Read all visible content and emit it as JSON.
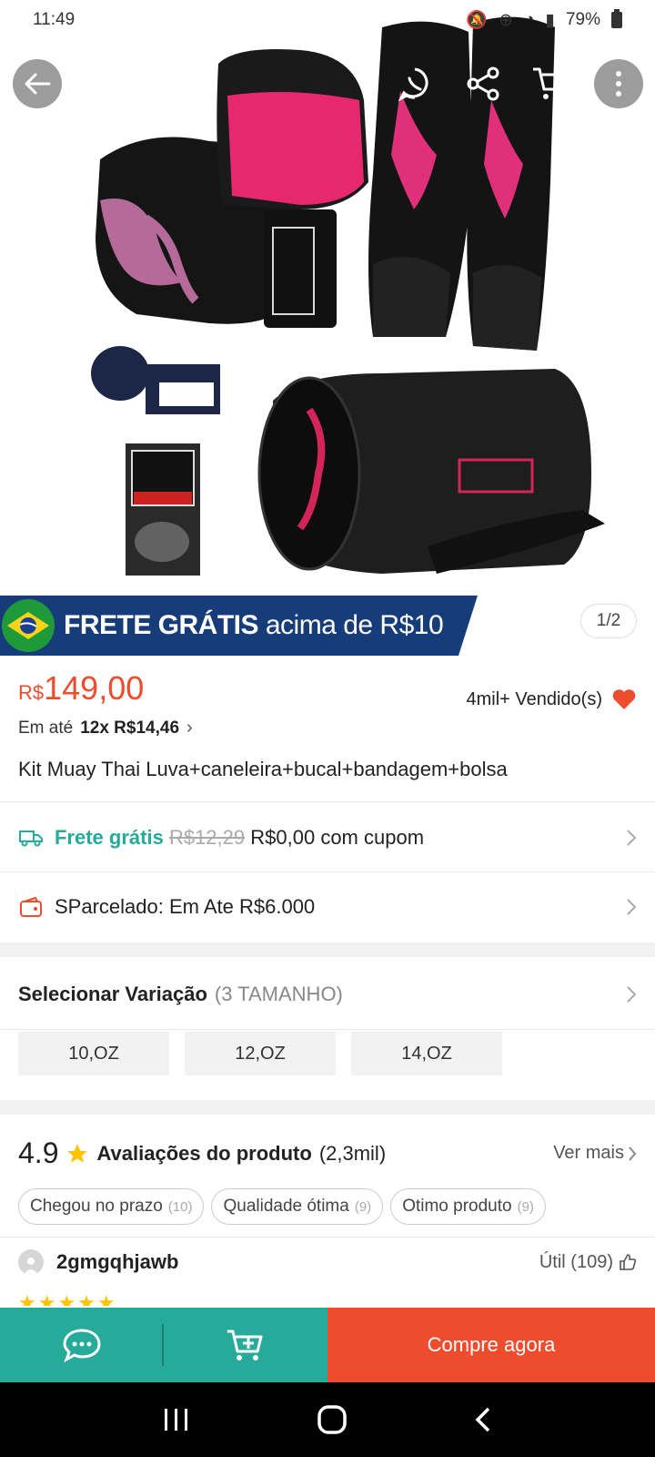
{
  "status_bar": {
    "time": "11:49",
    "battery": "79%"
  },
  "gallery": {
    "counter": "1/2"
  },
  "banner": {
    "bold": "FRETE GRÁTIS",
    "regular": "acima de R$10"
  },
  "price": {
    "currency": "R$",
    "amount": "149,00"
  },
  "sold": {
    "label": "4mil+ Vendido(s)"
  },
  "installments": {
    "prefix": "Em até",
    "value": "12x R$14,46"
  },
  "product": {
    "title": "Kit Muay Thai Luva+caneleira+bucal+bandagem+bolsa"
  },
  "shipping": {
    "label": "Frete grátis",
    "old_price": "R$12,29",
    "new_price": "R$0,00 com cupom"
  },
  "sparcelado": {
    "label": "SParcelado: Em Ate R$6.000"
  },
  "variation": {
    "title": "Selecionar Variação",
    "count": "(3 TAMANHO)",
    "options": [
      "10,OZ",
      "12,OZ",
      "14,OZ"
    ]
  },
  "ratings": {
    "score": "4.9",
    "label": "Avaliações do produto",
    "count": "(2,3mil)",
    "see_more": "Ver mais"
  },
  "tags": [
    {
      "label": "Chegou no prazo",
      "count": "(10)"
    },
    {
      "label": "Qualidade ótima",
      "count": "(9)"
    },
    {
      "label": "Otimo produto",
      "count": "(9)"
    }
  ],
  "review": {
    "user": "2gmgqhjawb",
    "helpful": "Útil (109)",
    "stars": "★★★★★"
  },
  "actions": {
    "buy_now": "Compre agora"
  },
  "colors": {
    "primary": "#ee4d2d",
    "teal": "#26aa99",
    "banner": "#173c7a"
  }
}
